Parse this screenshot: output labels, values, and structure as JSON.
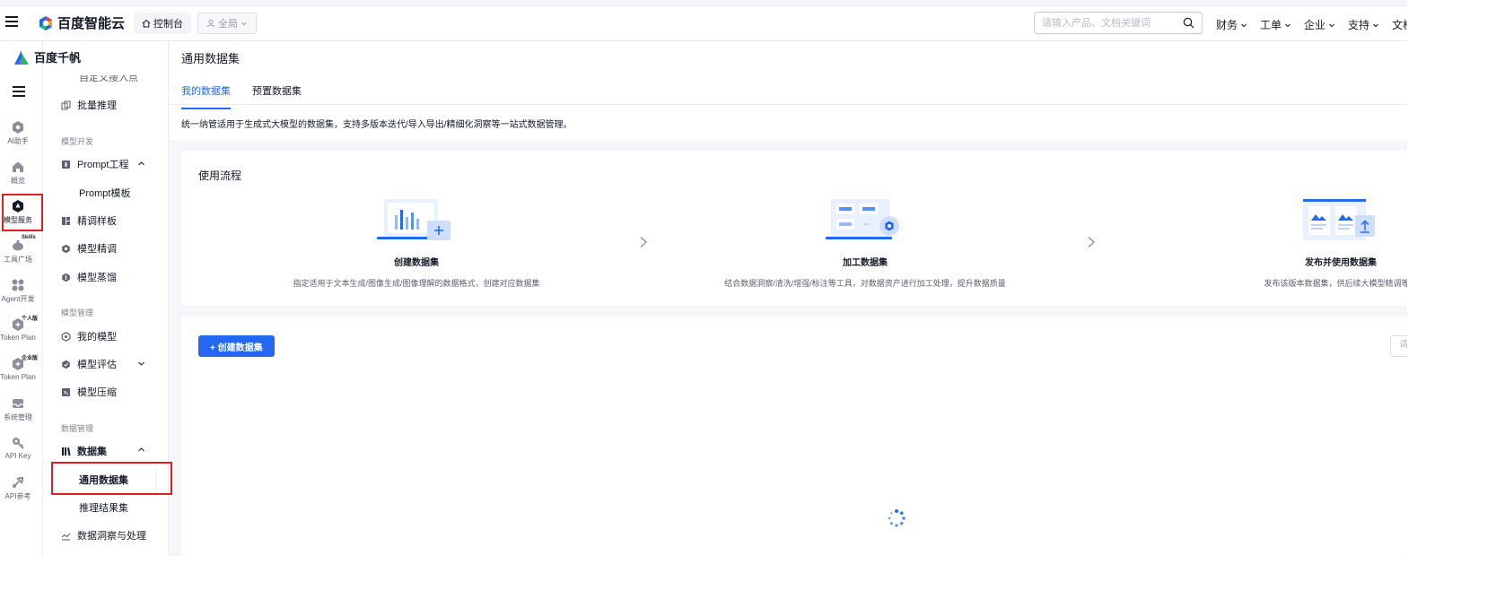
{
  "topbar": {
    "brand": "百度智能云",
    "console_label": "控制台",
    "scope_label": "全局",
    "search_placeholder": "请输入产品、文档关键词",
    "menu": [
      "财务",
      "工单",
      "企业",
      "支持",
      "文档"
    ]
  },
  "rail": {
    "logo_text": "百度千帆",
    "items": [
      {
        "label": "AI助手",
        "icon": "ai-assistant-icon"
      },
      {
        "label": "概览",
        "icon": "home-icon"
      },
      {
        "label": "模型服务",
        "icon": "model-service-icon",
        "active": true
      },
      {
        "label": "工具广场",
        "icon": "tools-icon",
        "badge": "Skills"
      },
      {
        "label": "Agent开发",
        "icon": "agent-icon"
      },
      {
        "label": "Token Plan",
        "icon": "token-plan-icon",
        "badge": "个人版"
      },
      {
        "label": "Token Plan",
        "icon": "token-plan-icon",
        "badge": "企业版"
      },
      {
        "label": "系统管理",
        "icon": "system-icon"
      },
      {
        "label": "API Key",
        "icon": "key-icon"
      },
      {
        "label": "API参考",
        "icon": "api-ref-icon"
      }
    ]
  },
  "sidebar": {
    "clipped_item": "自定义接入点",
    "batch_inference": "批量推理",
    "group_dev": "模型开发",
    "prompt_engineering": "Prompt工程",
    "prompt_template": "Prompt模板",
    "fine_tune_samples": "精调样板",
    "fine_tune": "模型精调",
    "distill": "模型蒸馏",
    "group_manage": "模型管理",
    "my_models": "我的模型",
    "model_eval": "模型评估",
    "model_compress": "模型压缩",
    "group_data": "数据管理",
    "datasets": "数据集",
    "general_dataset": "通用数据集",
    "inference_results": "推理结果集",
    "data_insight": "数据洞察与处理"
  },
  "main": {
    "title": "通用数据集",
    "tabs": [
      {
        "label": "我的数据集",
        "active": true
      },
      {
        "label": "预置数据集",
        "active": false
      }
    ],
    "description": "统一纳管适用于生成式大模型的数据集，支持多版本迭代/导入导出/精细化洞察等一站式数据管理。",
    "flow": {
      "title": "使用流程",
      "steps": [
        {
          "name": "创建数据集",
          "desc": "指定适用于文本生成/图像生成/图像理解的数据格式，创建对应数据集"
        },
        {
          "name": "加工数据集",
          "desc": "结合数据洞察/清洗/增强/标注等工具，对数据资产进行加工处理，提升数据质量"
        },
        {
          "name": "发布并使用数据集",
          "desc": "发布该版本数据集，供后续大模型精调等环"
        }
      ]
    },
    "create_button": "+ 创建数据集",
    "list_search_placeholder": "请"
  },
  "colors": {
    "accent": "#2468f2",
    "highlight": "#e02020"
  }
}
